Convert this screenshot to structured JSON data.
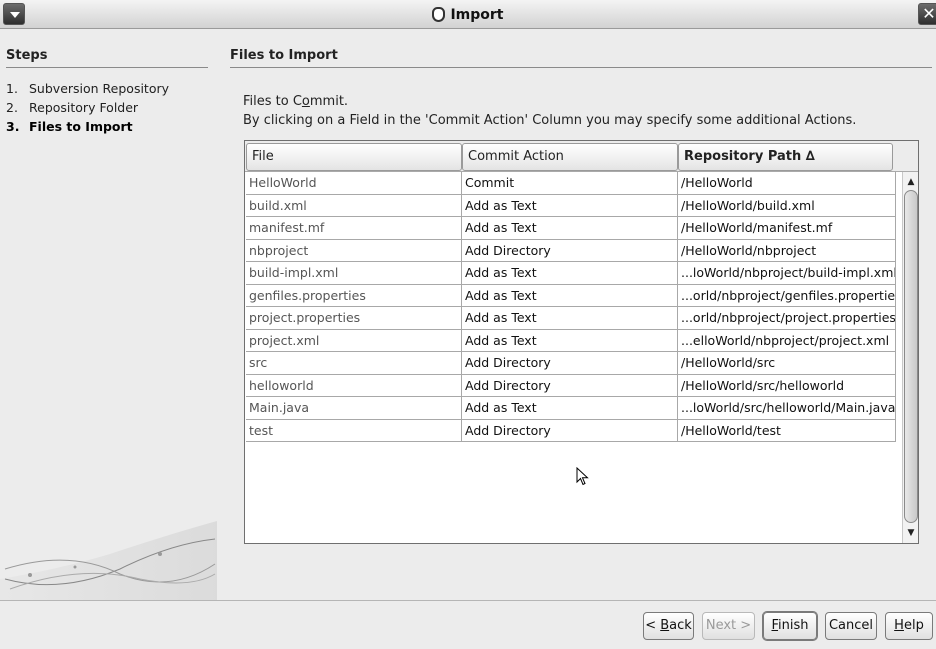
{
  "window": {
    "title": "Import"
  },
  "steps": {
    "header": "Steps",
    "items": [
      {
        "num": "1.",
        "label": "Subversion Repository",
        "active": false
      },
      {
        "num": "2.",
        "label": "Repository Folder",
        "active": false
      },
      {
        "num": "3.",
        "label": "Files to Import",
        "active": true
      }
    ]
  },
  "main": {
    "header": "Files to Import",
    "desc_line1_pre": "Files to C",
    "desc_line1_u": "o",
    "desc_line1_post": "mmit.",
    "desc_line2": "By clicking on a Field in the 'Commit Action' Column you may specify some additional Actions."
  },
  "table": {
    "columns": [
      "File",
      "Commit Action",
      "Repository Path ∆"
    ],
    "sorted_column": "Repository Path",
    "rows": [
      {
        "file": "HelloWorld",
        "action": "Commit",
        "path": "/HelloWorld"
      },
      {
        "file": "build.xml",
        "action": "Add as Text",
        "path": "/HelloWorld/build.xml"
      },
      {
        "file": "manifest.mf",
        "action": "Add as Text",
        "path": "/HelloWorld/manifest.mf"
      },
      {
        "file": "nbproject",
        "action": "Add Directory",
        "path": "/HelloWorld/nbproject"
      },
      {
        "file": "build-impl.xml",
        "action": "Add as Text",
        "path": "...loWorld/nbproject/build-impl.xml"
      },
      {
        "file": "genfiles.properties",
        "action": "Add as Text",
        "path": "...orld/nbproject/genfiles.properties"
      },
      {
        "file": "project.properties",
        "action": "Add as Text",
        "path": "...orld/nbproject/project.properties"
      },
      {
        "file": "project.xml",
        "action": "Add as Text",
        "path": "...elloWorld/nbproject/project.xml"
      },
      {
        "file": "src",
        "action": "Add Directory",
        "path": "/HelloWorld/src"
      },
      {
        "file": "helloworld",
        "action": "Add Directory",
        "path": "/HelloWorld/src/helloworld"
      },
      {
        "file": "Main.java",
        "action": "Add as Text",
        "path": "...loWorld/src/helloworld/Main.java"
      },
      {
        "file": "test",
        "action": "Add Directory",
        "path": "/HelloWorld/test"
      }
    ]
  },
  "buttons": {
    "back_pre": "< ",
    "back_u": "B",
    "back_post": "ack",
    "next": "Next >",
    "finish_u": "F",
    "finish_post": "inish",
    "cancel": "Cancel",
    "help_u": "H",
    "help_post": "elp"
  },
  "colors": {
    "background": "#ececec",
    "table_bg": "#ffffff",
    "grid": "#a8a8a8"
  }
}
